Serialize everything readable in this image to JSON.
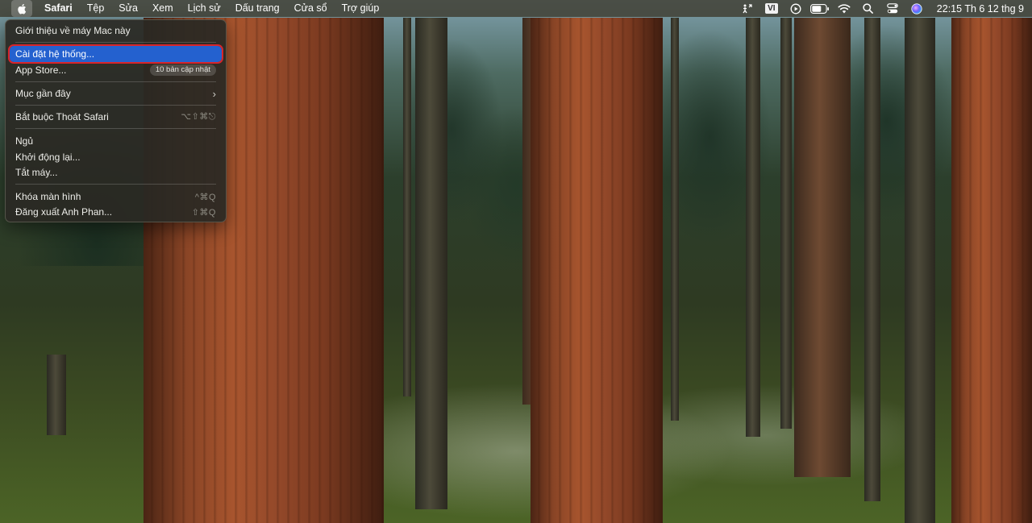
{
  "menubar": {
    "apple_icon": "apple-logo-icon",
    "app_name": "Safari",
    "menus": [
      "Tệp",
      "Sửa",
      "Xem",
      "Lịch sử",
      "Dấu trang",
      "Cửa sổ",
      "Trợ giúp"
    ],
    "status": {
      "input_source": "VI",
      "icons": [
        "accessibility-icon",
        "input-source-icon",
        "now-playing-icon",
        "battery-icon",
        "wifi-icon",
        "spotlight-search-icon",
        "control-center-icon",
        "siri-icon"
      ]
    },
    "clock": "22:15 Th 6 12 thg 9"
  },
  "apple_menu": {
    "items": [
      {
        "label": "Giới thiệu về máy Mac này",
        "shortcut": ""
      },
      {
        "label": "Cài đặt hệ thống...",
        "shortcut": "",
        "selected": true
      },
      {
        "label": "App Store...",
        "badge": "10 bản cập nhật"
      },
      {
        "label": "Mục gần đây",
        "submenu": true
      },
      {
        "label": "Bắt buộc Thoát Safari",
        "shortcut": "⌥⇧⌘⎋"
      },
      {
        "label": "Ngủ",
        "shortcut": ""
      },
      {
        "label": "Khởi động lại...",
        "shortcut": ""
      },
      {
        "label": "Tắt máy...",
        "shortcut": ""
      },
      {
        "label": "Khóa màn hình",
        "shortcut": "^⌘Q"
      },
      {
        "label": "Đăng xuất Anh Phan...",
        "shortcut": "⇧⌘Q"
      }
    ]
  },
  "colors": {
    "selection": "#2461cf",
    "highlight_outline": "#d8252a",
    "menu_bg": "#2a2924"
  }
}
